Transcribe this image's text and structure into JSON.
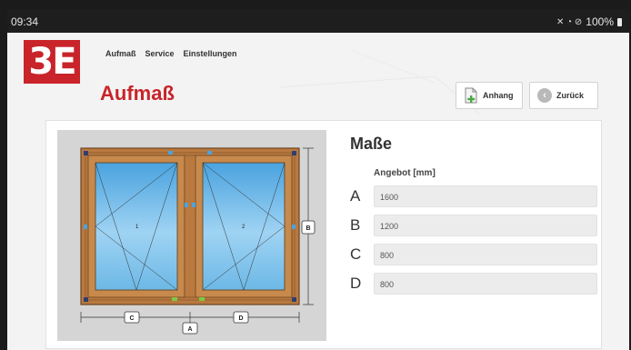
{
  "status_bar": {
    "time": "09:34",
    "battery": "100%"
  },
  "logo": {
    "text": "3E"
  },
  "nav": {
    "items": [
      "Aufmaß",
      "Service",
      "Einstellungen"
    ]
  },
  "page": {
    "title": "Aufmaß"
  },
  "buttons": {
    "attach_label": "Anhang",
    "back_label": "Zurück"
  },
  "drawing": {
    "pane_numbers": [
      "1",
      "2"
    ],
    "dim_labels": {
      "A": "A",
      "B": "B",
      "C": "C",
      "D": "D"
    }
  },
  "dimensions": {
    "title": "Maße",
    "column_header": "Angebot [mm]",
    "rows": [
      {
        "letter": "A",
        "value": "1600"
      },
      {
        "letter": "B",
        "value": "1200"
      },
      {
        "letter": "C",
        "value": "800"
      },
      {
        "letter": "D",
        "value": "800"
      }
    ]
  },
  "colors": {
    "brand": "#c8242a",
    "frame": "#b9793f",
    "glass": "#6cb8e6"
  }
}
